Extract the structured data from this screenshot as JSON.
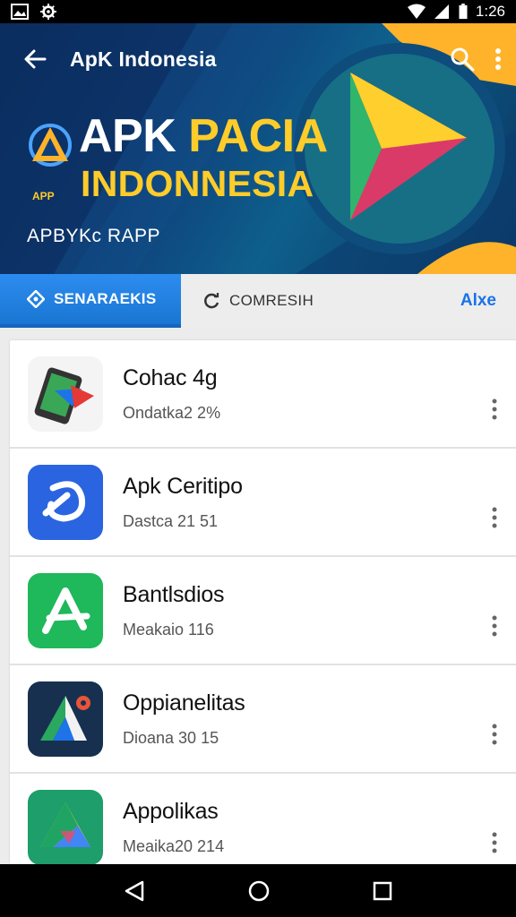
{
  "status_bar": {
    "time": "1:26",
    "left_icons": [
      "image-icon",
      "settings-icon"
    ],
    "right_icons": [
      "wifi-icon",
      "signal-icon",
      "battery-icon"
    ]
  },
  "app_bar": {
    "title": "ApK Indonesia",
    "icons": [
      "back-arrow-icon",
      "search-icon",
      "more-vert-icon"
    ]
  },
  "hero": {
    "line1_word1": "APK",
    "line1_word2": "PACIA",
    "line2": "INDONNESIA",
    "logo_caption": "APP",
    "subtitle": "APBYKc RAPP"
  },
  "tabs": [
    {
      "label": "SENARAEKIS",
      "icon": "shield-icon",
      "active": true
    },
    {
      "label": "COMRESIH",
      "icon": "refresh-icon",
      "active": false
    }
  ],
  "tabs_more_label": "Alxe",
  "apps": [
    {
      "name": "Cohac 4g",
      "meta": "Ondatka2 2%",
      "icon": "phone-app-icon"
    },
    {
      "name": "Apk Ceritipo",
      "meta": "Dastca 21 51",
      "icon": "blue-swirl-app-icon"
    },
    {
      "name": "Bantlsdios",
      "meta": "Meakaio 116",
      "icon": "green-a-app-icon"
    },
    {
      "name": "Oppianelitas",
      "meta": "Dioana 30 15",
      "icon": "navy-a-map-app-icon"
    },
    {
      "name": "Appolikas",
      "meta": "Meaika20 214",
      "icon": "drive-triangle-app-icon"
    }
  ],
  "nav_bar": {
    "icons": [
      "back-triangle-icon",
      "home-circle-icon",
      "recents-square-icon"
    ]
  },
  "colors": {
    "accent": "#1976d2",
    "hero_yellow": "#ffcc29",
    "hero_bg": "#0f3f7a"
  }
}
